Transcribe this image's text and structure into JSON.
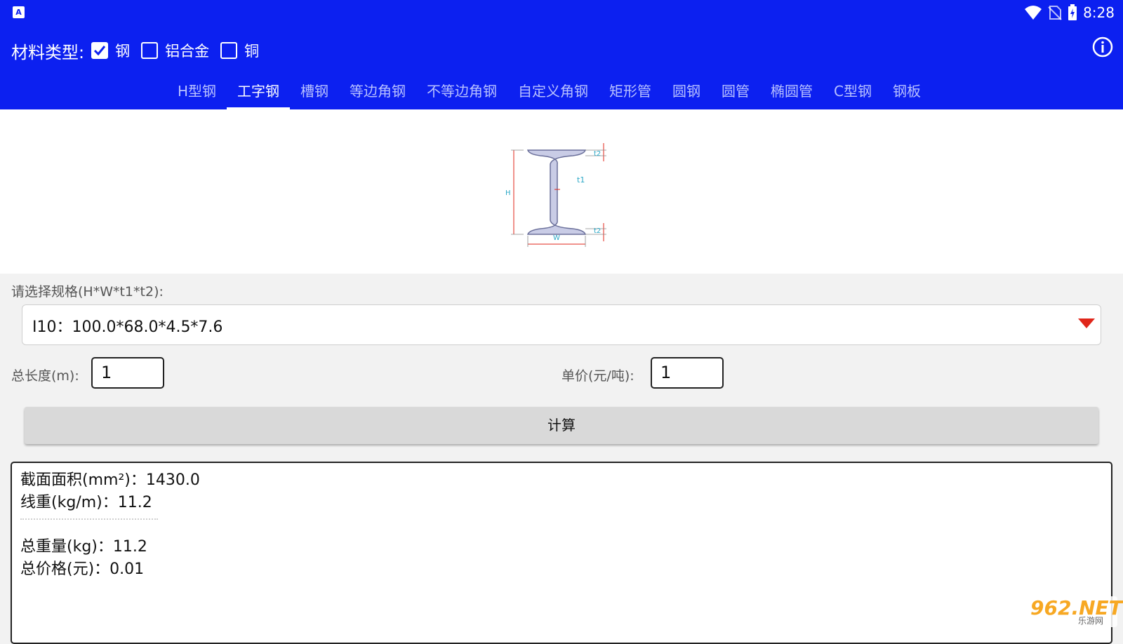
{
  "status_bar": {
    "time": "8:28",
    "app_icon_letter": "A"
  },
  "header": {
    "material_label": "材料类型:",
    "materials": [
      {
        "label": "钢",
        "checked": true
      },
      {
        "label": "铝合金",
        "checked": false
      },
      {
        "label": "铜",
        "checked": false
      }
    ],
    "info_icon": "info-icon"
  },
  "tabs": [
    {
      "label": "H型钢",
      "active": false
    },
    {
      "label": "工字钢",
      "active": true
    },
    {
      "label": "槽钢",
      "active": false
    },
    {
      "label": "等边角钢",
      "active": false
    },
    {
      "label": "不等边角钢",
      "active": false
    },
    {
      "label": "自定义角钢",
      "active": false
    },
    {
      "label": "矩形管",
      "active": false
    },
    {
      "label": "圆钢",
      "active": false
    },
    {
      "label": "圆管",
      "active": false
    },
    {
      "label": "椭圆管",
      "active": false
    },
    {
      "label": "C型钢",
      "active": false
    },
    {
      "label": "钢板",
      "active": false
    }
  ],
  "diagram": {
    "labels": {
      "h": "H",
      "w": "W",
      "t1": "t1",
      "t2": "t2"
    }
  },
  "form": {
    "spec_label": "请选择规格(H*W*t1*t2):",
    "spec_value": "I10：100.0*68.0*4.5*7.6",
    "length_label": "总长度(m):",
    "length_value": "1",
    "price_label": "单价(元/吨):",
    "price_value": "1",
    "calc_button": "计算"
  },
  "result": {
    "area": "截面面积(mm²)：1430.0",
    "linear_weight": "线重(kg/m)：11.2",
    "total_weight": "总重量(kg)：11.2",
    "total_price": "总价格(元)：0.01"
  },
  "watermark": {
    "main": "962.NET",
    "sub": "乐游网"
  },
  "colors": {
    "primary": "#0c20f0",
    "dropdown_arrow": "#e0261a",
    "beam_fill": "#c9cce6",
    "dimension_red": "#e0261a"
  }
}
